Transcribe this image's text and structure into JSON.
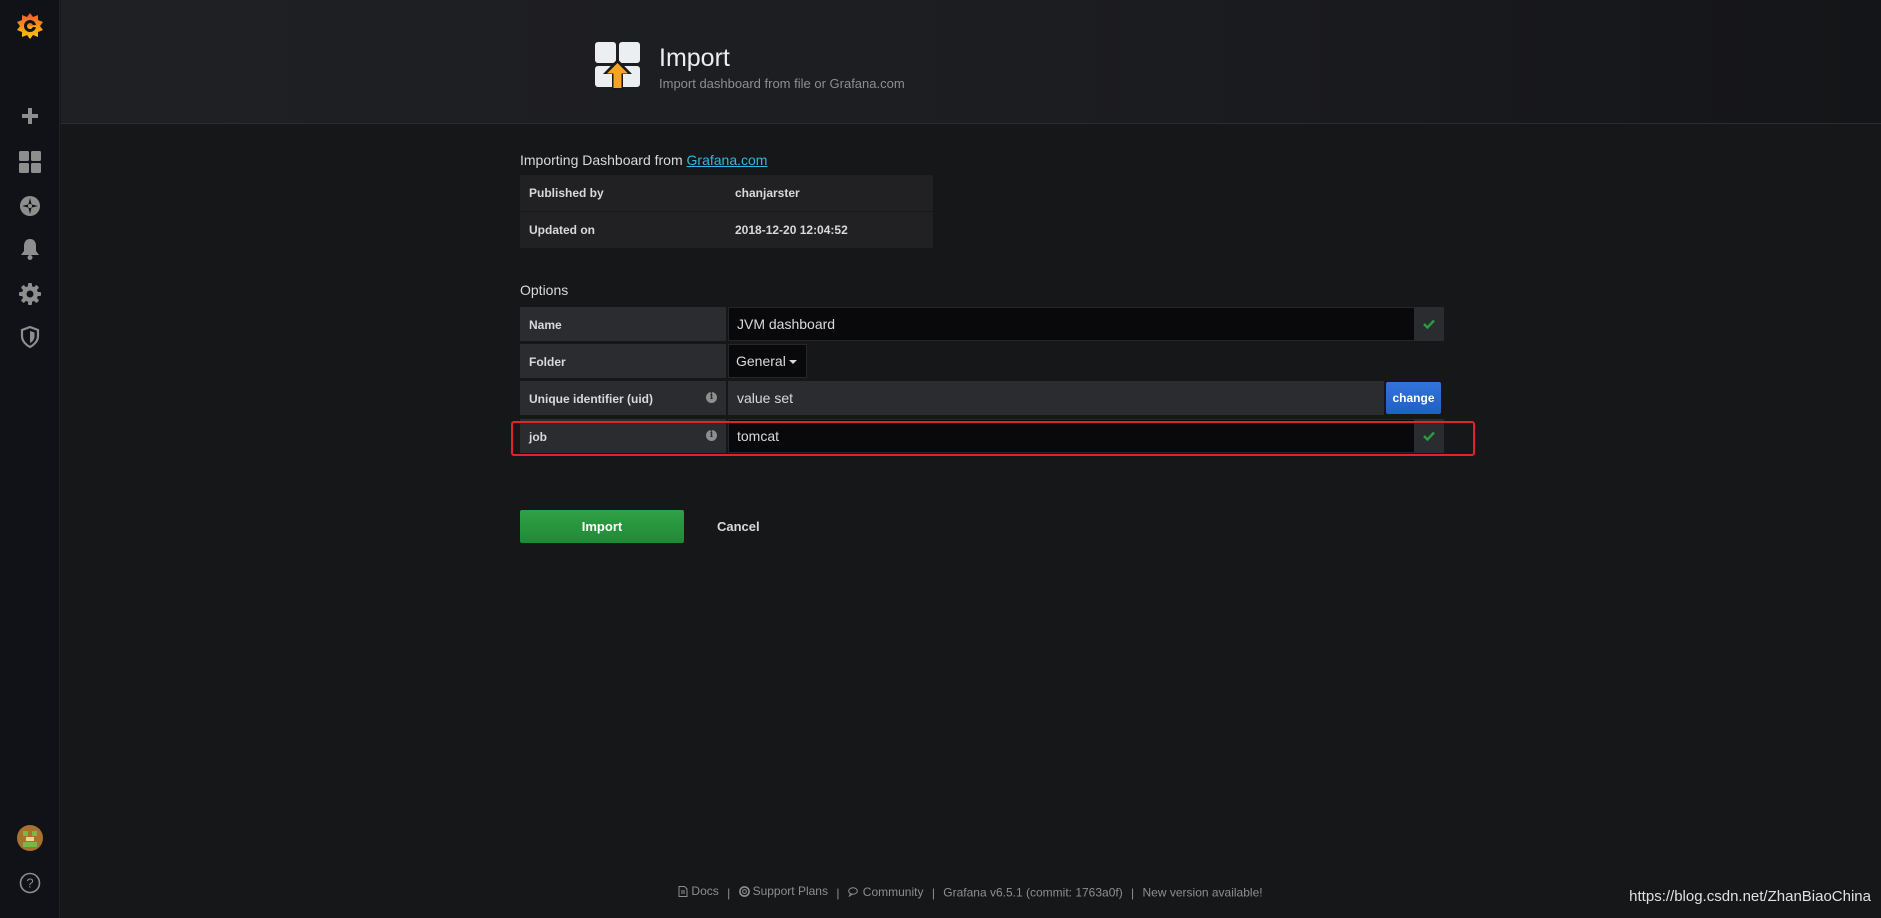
{
  "header": {
    "title": "Import",
    "subtitle": "Import dashboard from file or Grafana.com"
  },
  "source": {
    "prefix": "Importing Dashboard from ",
    "link_text": "Grafana.com"
  },
  "info": [
    {
      "label": "Published by",
      "value": "chanjarster"
    },
    {
      "label": "Updated on",
      "value": "2018-12-20 12:04:52"
    }
  ],
  "options": {
    "title": "Options",
    "name_label": "Name",
    "name_value": "JVM dashboard",
    "folder_label": "Folder",
    "folder_value": "General",
    "uid_label": "Unique identifier (uid)",
    "uid_value": "value set",
    "change_label": "change",
    "job_label": "job",
    "job_value": "tomcat"
  },
  "actions": {
    "import_label": "Import",
    "cancel_label": "Cancel"
  },
  "footer": {
    "docs": "Docs",
    "support": "Support Plans",
    "community": "Community",
    "version": "Grafana v6.5.1 (commit: 1763a0f)",
    "new_version": "New version available!",
    "separator": "|"
  },
  "watermark": "https://blog.csdn.net/ZhanBiaoChina",
  "colors": {
    "accent_orange": "#f47a20",
    "success_green": "#299c46",
    "primary_blue": "#3274d9",
    "highlight_red": "#e0242a",
    "link_blue": "#33b5e5"
  },
  "icons": {
    "sidebar": [
      "grafana-logo-icon",
      "plus-icon",
      "dashboards-icon",
      "explore-compass-icon",
      "bell-alert-icon",
      "gear-icon",
      "shield-icon",
      "avatar",
      "help-icon"
    ]
  }
}
